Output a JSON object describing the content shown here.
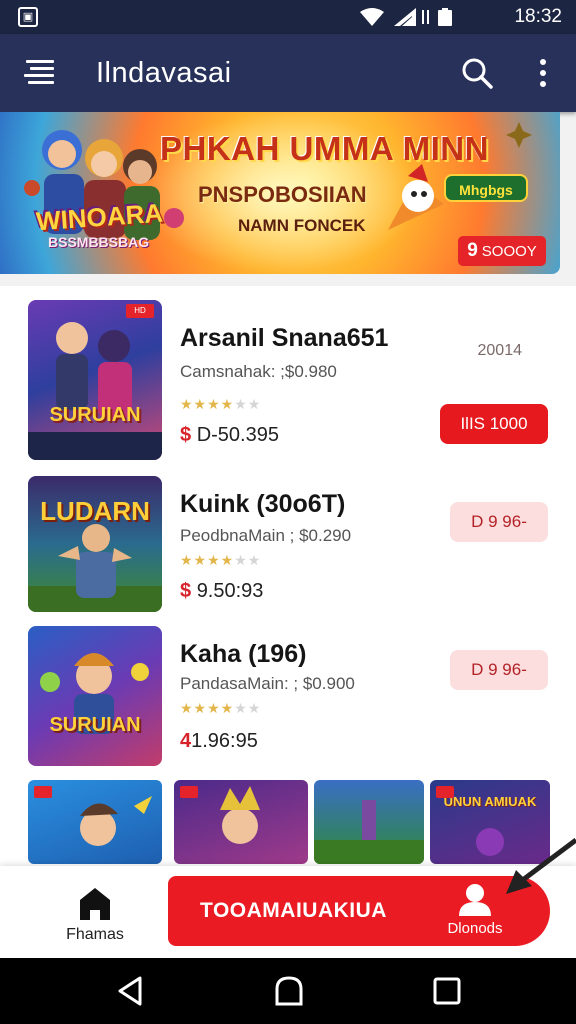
{
  "status_bar": {
    "time": "18:32",
    "notification_glyph": "▣"
  },
  "app_bar": {
    "title": "Ilndavasai"
  },
  "banner": {
    "headline": "PHKAH UMMA MINN",
    "subheadline": "PNSPOBOSIIAN",
    "tagline": "NAMN FONCEK",
    "game_logo": "WINOARA",
    "game_logo_sub": "BSSMBBSBAG",
    "badge_logo": "Mhgbgs",
    "price_symbol": "9",
    "price_text": "SOOOY"
  },
  "items": [
    {
      "name": "Arsanil Snana651",
      "subtitle": "Camsnahak: ;$0.980",
      "currency": "$",
      "price": "D-50.395",
      "date": "20014",
      "button": "IlIS 1000",
      "rating": 4,
      "thumb_word": "SURUIAN"
    },
    {
      "name": "Kuink (30o6T)",
      "subtitle": "PeodbnaMain ; $0.290",
      "currency": "$",
      "price": "9.50:93",
      "date": "",
      "button": "D 9 96-",
      "rating": 4,
      "thumb_word": "LUDARN"
    },
    {
      "name": "Kaha (196)",
      "subtitle": "PandasaMain: ; $0.900",
      "currency": "4",
      "price": "1.96:95",
      "date": "",
      "button": "D 9 96-",
      "rating": 4,
      "thumb_word": "SURUIAN"
    }
  ],
  "gallery": {
    "tile_count": 4,
    "last_tile_text": "UNUN AMIUAK"
  },
  "bottom_nav": {
    "home_label": "Fhamas",
    "cta_label": "TOOAMAIUAKIUA",
    "account_label": "Dlonods"
  },
  "colors": {
    "accent": "#e5191e",
    "appbar": "#27315a",
    "statusbar": "#1c2542"
  }
}
